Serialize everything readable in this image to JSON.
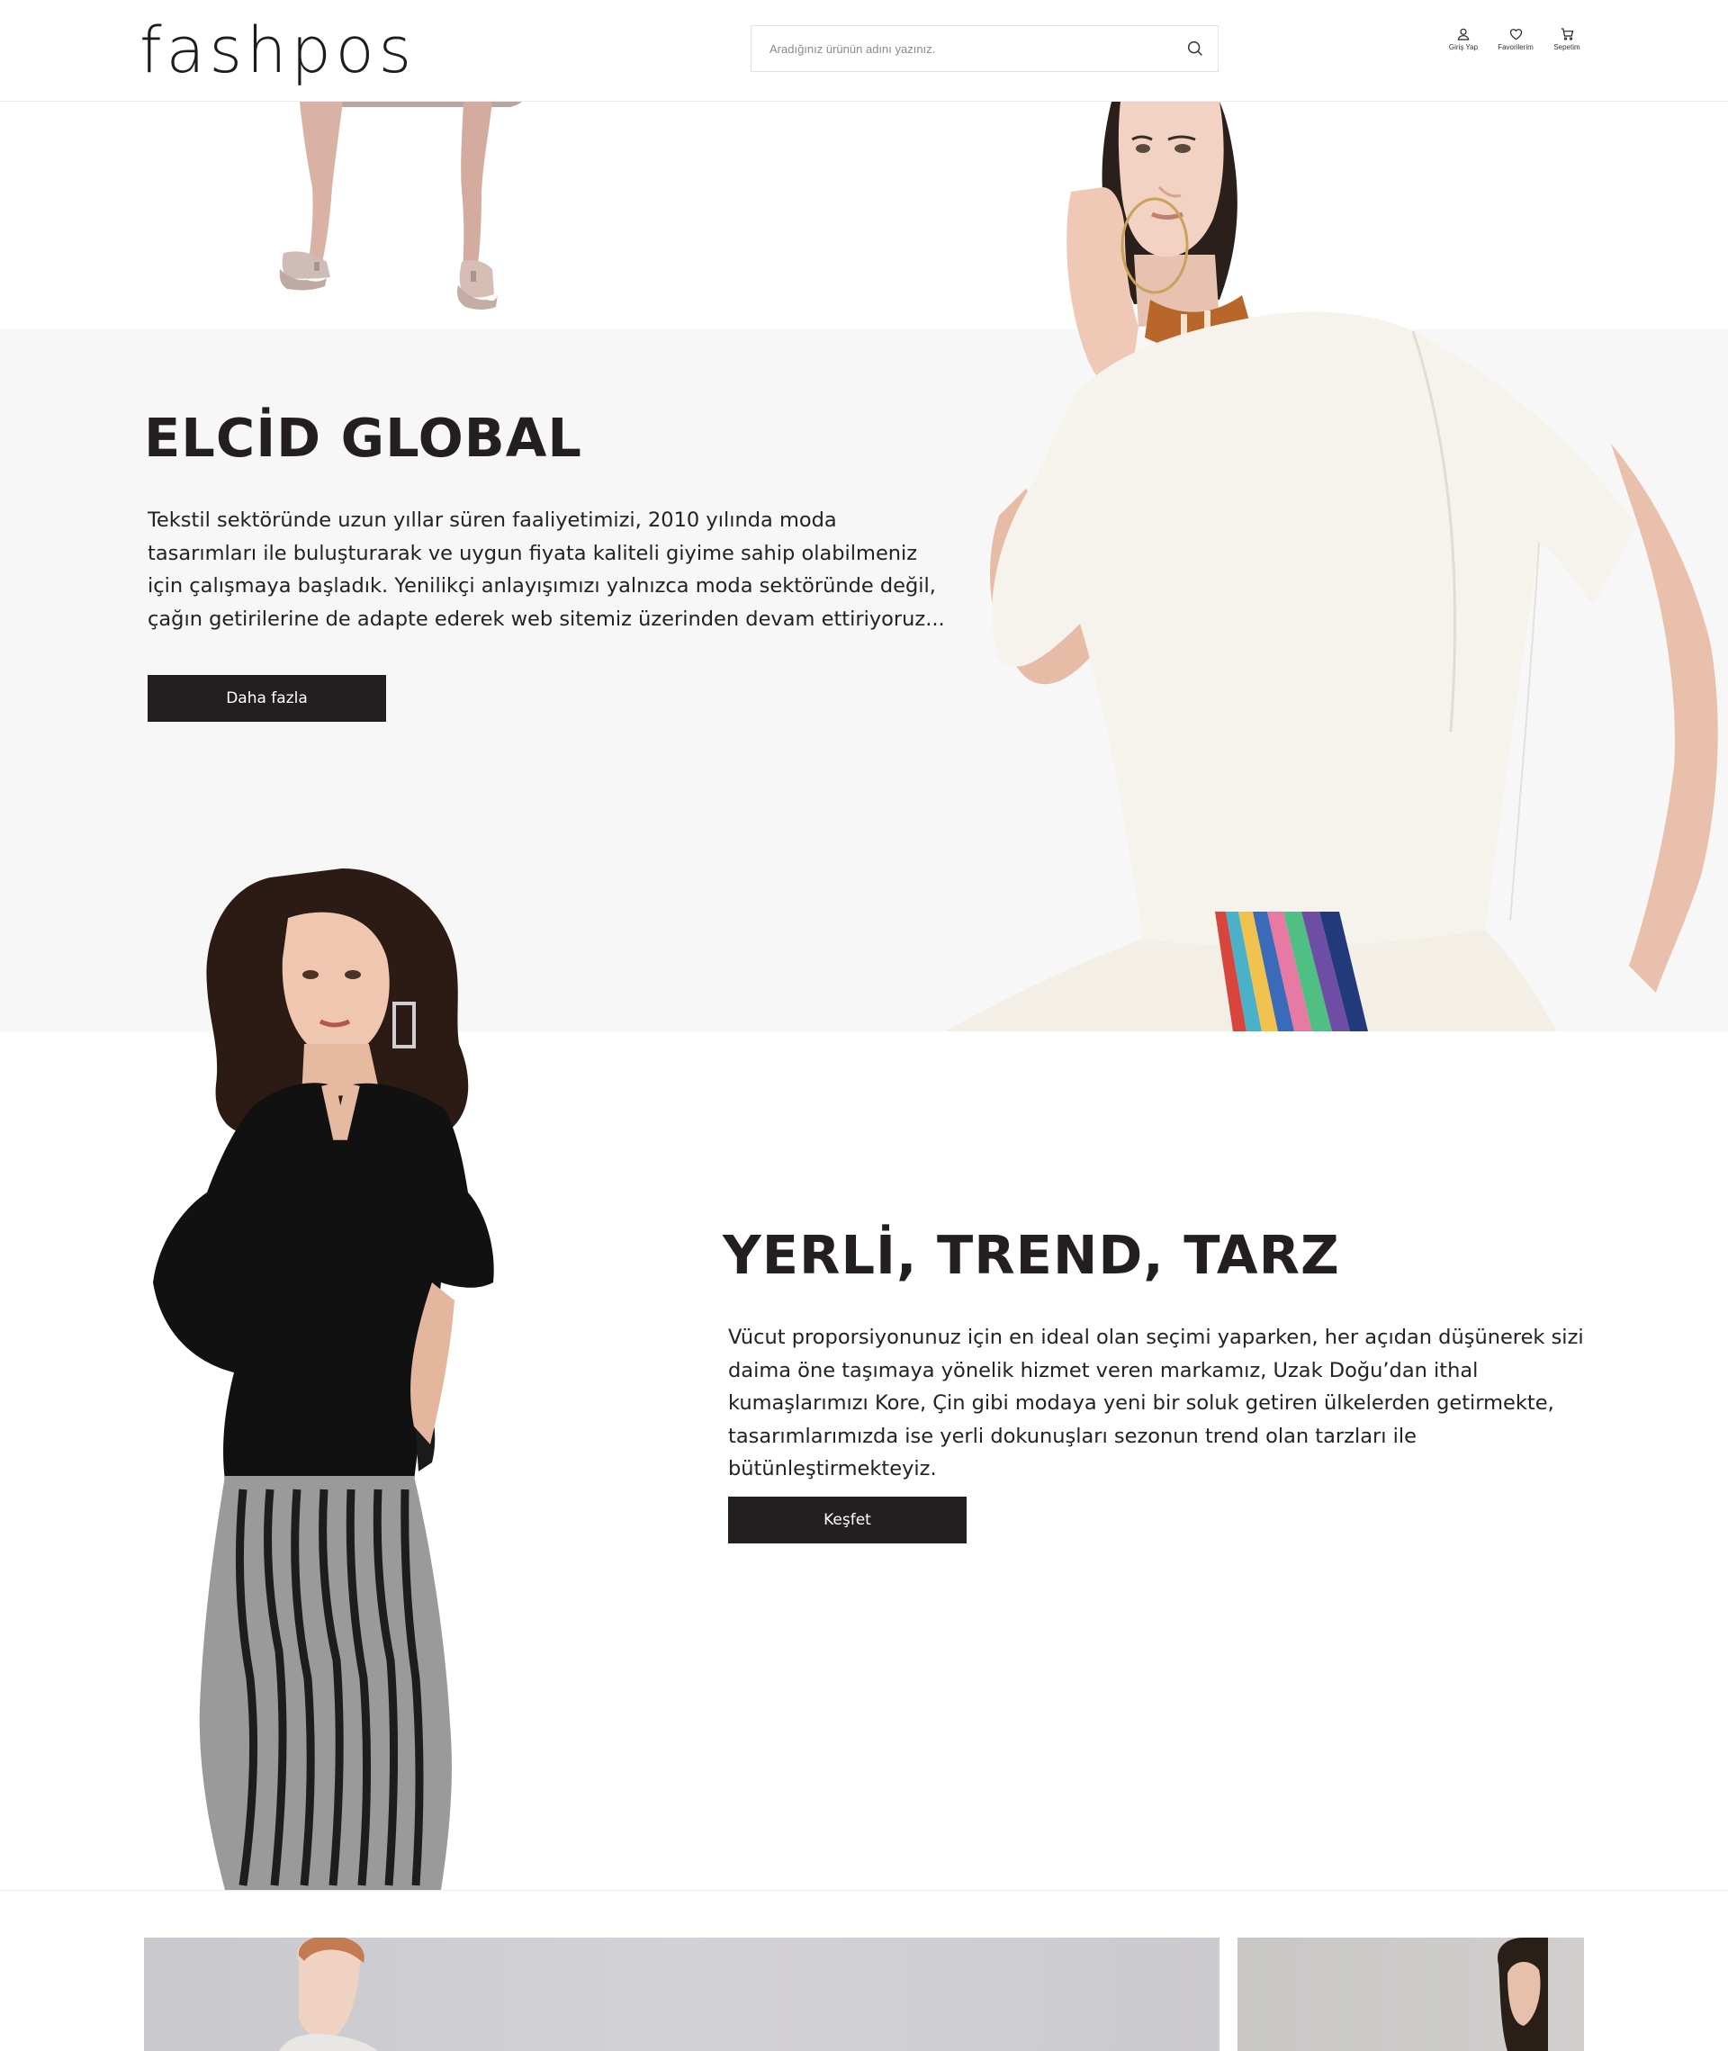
{
  "header": {
    "logo": "fashpos",
    "search": {
      "placeholder": "Aradığınız ürünün adını yazınız."
    },
    "icons": [
      {
        "name": "user-icon",
        "label": "Giriş Yap"
      },
      {
        "name": "heart-icon",
        "label": "Favorilerim"
      },
      {
        "name": "cart-icon",
        "label": "Sepetim"
      }
    ]
  },
  "section_about": {
    "title": "ELCİD GLOBAL",
    "text": "Tekstil sektöründe uzun yıllar süren faaliyetimizi, 2010 yılında moda tasarımları ile buluşturarak ve uygun fiyata kaliteli giyime sahip olabilmeniz için çalışmaya başladık. Yenilikçi anlayışımızı yalnızca moda sektöründe değil, çağın getirilerine de adapte ederek web sitemiz üzerinden devam ettiriyoruz...",
    "button": "Daha fazla"
  },
  "section_trend": {
    "title": "YERLİ, TREND, TARZ",
    "text": "Vücut proporsiyonunuz için en ideal olan seçimi yaparken, her açıdan düşünerek sizi daima öne taşımaya yönelik hizmet veren markamız, Uzak Doğu’dan ithal kumaşlarımızı Kore, Çin gibi modaya yeni bir soluk getiren ülkelerden getirmekte, tasarımlarımızda ise yerli dokunuşları sezonun trend olan tarzları ile bütünleştirmekteyiz.",
    "button": "Keşfet"
  },
  "colors": {
    "accent": "#231f20",
    "section_bg": "#f7f7f7",
    "border": "#ececec"
  }
}
